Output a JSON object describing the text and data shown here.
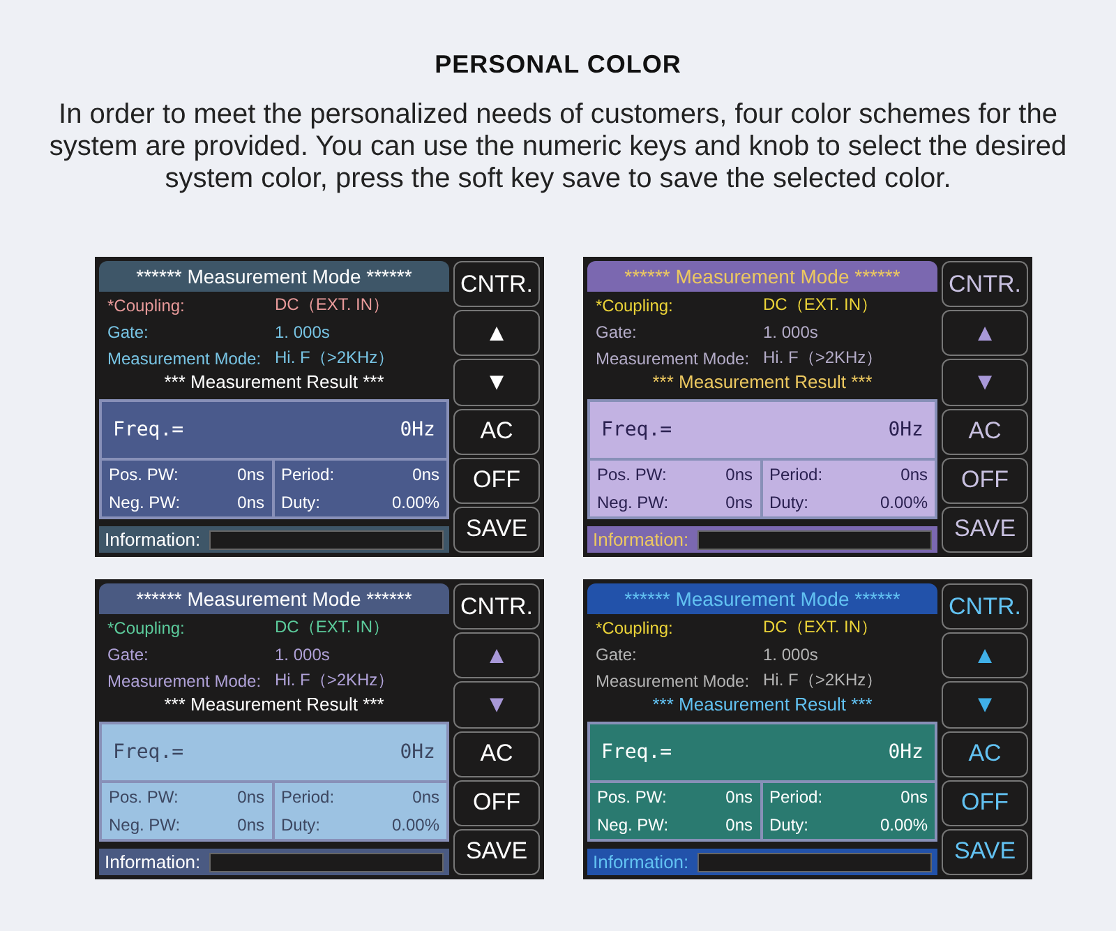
{
  "title": "PERSONAL COLOR",
  "description": "In order to meet the personalized needs of customers, four color schemes for the system are provided. You can use the numeric keys and knob to select the desired system color, press the soft key save to save the selected color.",
  "screens": [
    {
      "kind": "slate",
      "header": "****** Measurement Mode ******",
      "coupling_label": "*Coupling:",
      "coupling_value": "DC（EXT. IN）",
      "gate_label": "Gate:",
      "gate_value": "1. 000s",
      "mode_label": "Measurement Mode:",
      "mode_value": "Hi. F（>2KHz）",
      "result_title": "*** Measurement Result ***",
      "freq_label": "Freq.=",
      "freq_value": "0Hz",
      "cells": [
        [
          "Pos. PW:",
          "0ns"
        ],
        [
          "Period:",
          "0ns"
        ],
        [
          "Neg. PW:",
          "0ns"
        ],
        [
          "Duty:",
          "0.00%"
        ]
      ],
      "info_label": "Information:",
      "buttons": [
        "CNTR.",
        "▲",
        "▼",
        "AC",
        "OFF",
        "SAVE"
      ]
    },
    {
      "kind": "violet",
      "header": "****** Measurement Mode ******",
      "coupling_label": "*Coupling:",
      "coupling_value": "DC（EXT. IN）",
      "gate_label": "Gate:",
      "gate_value": "1. 000s",
      "mode_label": "Measurement Mode:",
      "mode_value": "Hi. F（>2KHz）",
      "result_title": "*** Measurement Result ***",
      "freq_label": "Freq.=",
      "freq_value": "0Hz",
      "cells": [
        [
          "Pos. PW:",
          "0ns"
        ],
        [
          "Period:",
          "0ns"
        ],
        [
          "Neg. PW:",
          "0ns"
        ],
        [
          "Duty:",
          "0.00%"
        ]
      ],
      "info_label": "Information:",
      "buttons": [
        "CNTR.",
        "▲",
        "▼",
        "AC",
        "OFF",
        "SAVE"
      ]
    },
    {
      "kind": "sky",
      "header": "****** Measurement Mode ******",
      "coupling_label": "*Coupling:",
      "coupling_value": "DC（EXT. IN）",
      "gate_label": "Gate:",
      "gate_value": "1. 000s",
      "mode_label": "Measurement Mode:",
      "mode_value": "Hi. F（>2KHz）",
      "result_title": "*** Measurement Result ***",
      "freq_label": "Freq.=",
      "freq_value": "0Hz",
      "cells": [
        [
          "Pos. PW:",
          "0ns"
        ],
        [
          "Period:",
          "0ns"
        ],
        [
          "Neg. PW:",
          "0ns"
        ],
        [
          "Duty:",
          "0.00%"
        ]
      ],
      "info_label": "Information:",
      "buttons": [
        "CNTR.",
        "▲",
        "▼",
        "AC",
        "OFF",
        "SAVE"
      ]
    },
    {
      "kind": "teal",
      "header": "****** Measurement Mode ******",
      "coupling_label": "*Coupling:",
      "coupling_value": "DC（EXT. IN）",
      "gate_label": "Gate:",
      "gate_value": "1. 000s",
      "mode_label": "Measurement Mode:",
      "mode_value": "Hi. F（>2KHz）",
      "result_title": "*** Measurement Result ***",
      "freq_label": "Freq.=",
      "freq_value": "0Hz",
      "cells": [
        [
          "Pos. PW:",
          "0ns"
        ],
        [
          "Period:",
          "0ns"
        ],
        [
          "Neg. PW:",
          "0ns"
        ],
        [
          "Duty:",
          "0.00%"
        ]
      ],
      "info_label": "Information:",
      "buttons": [
        "CNTR.",
        "▲",
        "▼",
        "AC",
        "OFF",
        "SAVE"
      ]
    }
  ]
}
